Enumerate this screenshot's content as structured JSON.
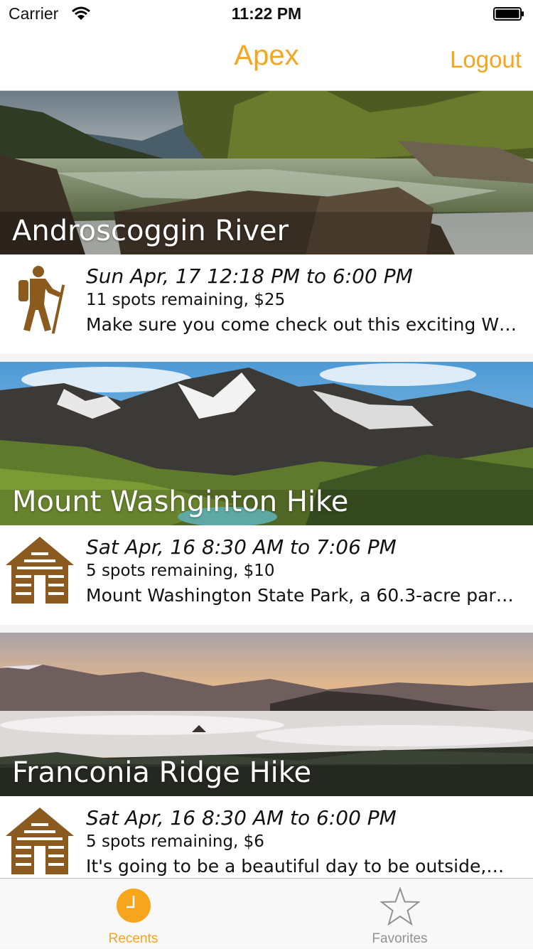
{
  "status_bar": {
    "carrier": "Carrier",
    "time": "11:22 PM"
  },
  "nav": {
    "title": "Apex",
    "logout_label": "Logout"
  },
  "events": [
    {
      "title": "Androscoggin River",
      "date": "Sun Apr, 17 12:18 PM to 6:00 PM",
      "spots": "11 spots remaining, $25",
      "description": "Make sure you come check out this exciting W…",
      "icon": "hiker-icon"
    },
    {
      "title": "Mount Washginton Hike",
      "date": "Sat Apr, 16 8:30 AM to 7:06 PM",
      "spots": "5 spots remaining, $10",
      "description": "Mount Washington State Park, a 60.3-acre par…",
      "icon": "cabin-icon"
    },
    {
      "title": "Franconia Ridge Hike",
      "date": "Sat Apr, 16 8:30 AM to 6:00 PM",
      "spots": "5 spots remaining, $6",
      "description": "It's going to be a beautiful day to be outside,…",
      "icon": "cabin-icon"
    }
  ],
  "tabs": [
    {
      "label": "Recents",
      "icon": "clock-icon",
      "selected": true
    },
    {
      "label": "Favorites",
      "icon": "star-icon",
      "selected": false
    }
  ],
  "colors": {
    "accent": "#f7a51d",
    "icon_brown": "#8a5a1e",
    "tab_inactive": "#929292"
  }
}
